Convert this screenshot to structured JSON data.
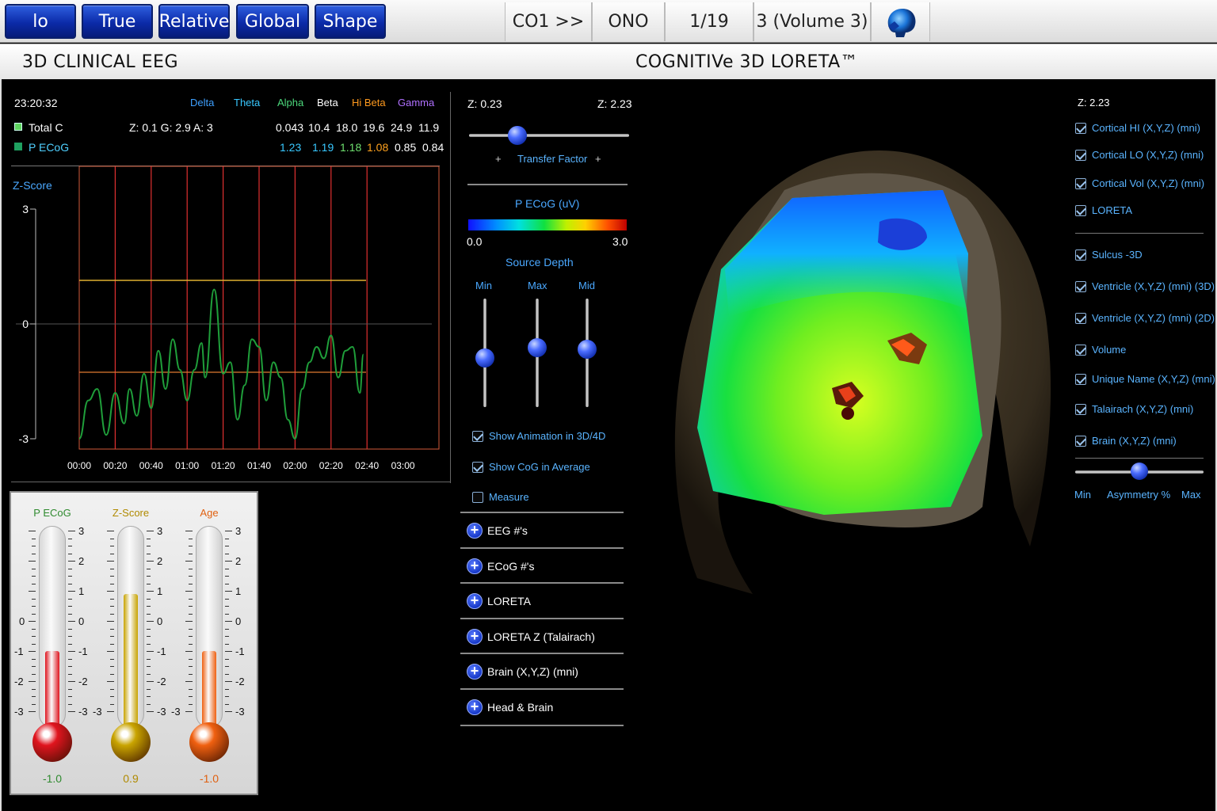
{
  "toolbar": {
    "buttons": [
      "lo",
      "True",
      "Relative",
      "Global",
      "Shape"
    ],
    "segments": [
      "CO1  >>",
      "ONO",
      "1/19",
      "3 (Volume 3)"
    ]
  },
  "title": {
    "left": "3D CLINICAL EEG",
    "right": "COGNITIVe 3D LORETA™"
  },
  "eeg": {
    "time": "23:20:32",
    "bands": [
      "Delta",
      "Theta",
      "Alpha",
      "Beta",
      "Hi Beta",
      "Gamma"
    ],
    "band_colors": [
      "#3ea0ff",
      "#38c8ff",
      "#4cd87c",
      "#ffffff",
      "#ff9a1e",
      "#b070ff"
    ],
    "row1": {
      "label": "Total C",
      "stats": "Z: 0.1   G: 2.9   A: 3",
      "values": [
        "0.043",
        "10.4",
        "18.0",
        "19.6",
        "24.9",
        "11.9"
      ]
    },
    "row2": {
      "label": "P ECoG",
      "values": [
        "1.23",
        "1.19",
        "1.18",
        "1.08",
        "0.85",
        "0.84"
      ],
      "value_colors": [
        "#38c8ff",
        "#38c8ff",
        "#6ee06e",
        "#ffa21e",
        "#ffffff",
        "#ffffff"
      ]
    }
  },
  "chart_data": {
    "type": "line",
    "title": "",
    "ylabel": "Z-Score",
    "xlabel": "",
    "ylim": [
      -3,
      3
    ],
    "yticks": [
      "3",
      "0",
      "-3"
    ],
    "xticks": [
      "00:00",
      "00:20",
      "00:40",
      "01:00",
      "01:20",
      "01:40",
      "02:00",
      "02:20",
      "02:40",
      "03:00"
    ],
    "series": [
      {
        "name": "P ECoG",
        "color": "#1f9e3a",
        "x": [
          0,
          5,
          10,
          15,
          20,
          25,
          28,
          32,
          36,
          40,
          44,
          48,
          52,
          56,
          60,
          64,
          68,
          70,
          75,
          80,
          84,
          88,
          92,
          96,
          100,
          104,
          108,
          112,
          116,
          120,
          124,
          128,
          132,
          136,
          140,
          144,
          148,
          152,
          156,
          158
        ],
        "values": [
          -3,
          -2.0,
          -1.7,
          -2.9,
          -1.8,
          -2.6,
          -1.7,
          -2.4,
          -1.3,
          -2.2,
          -0.7,
          -1.7,
          -0.4,
          -1.2,
          -2.0,
          -1.2,
          -0.5,
          -1.4,
          0.9,
          -1.3,
          -1.0,
          -2.5,
          -1.6,
          -0.4,
          -0.6,
          -2.0,
          -1.0,
          -1.4,
          -2.5,
          -3.0,
          -1.7,
          -1.0,
          -0.6,
          -0.9,
          -0.3,
          -1.4,
          -0.7,
          -0.6,
          -1.8,
          -0.8
        ]
      }
    ]
  },
  "controls": {
    "z_left": "Z: 0.23",
    "z_right": "Z: 2.23",
    "transfer": "Transfer Factor",
    "transfer_value": 0.3,
    "ecog_label": "P ECoG (uV)",
    "scale_min": "0.0",
    "scale_max": "3.0",
    "source_depth": "Source Depth",
    "depth_labels": [
      "Min",
      "Max",
      "Mid"
    ],
    "depth_values": [
      0.55,
      0.45,
      0.47
    ],
    "checks": [
      {
        "label": "Show Animation in 3D/4D",
        "checked": true
      },
      {
        "label": "Show CoG in Average",
        "checked": true
      },
      {
        "label": "Measure",
        "checked": false
      }
    ],
    "menu": [
      "EEG #'s",
      "ECoG #'s",
      "LORETA",
      "LORETA Z  (Talairach)",
      "Brain (X,Y,Z) (mni)",
      "Head & Brain"
    ]
  },
  "right_panel": {
    "z": "Z: 2.23",
    "checks": [
      "Cortical HI (X,Y,Z) (mni)",
      "Cortical LO (X,Y,Z) (mni)",
      "Cortical Vol (X,Y,Z) (mni)",
      "LORETA",
      "Sulcus -3D",
      "Ventricle (X,Y,Z) (mni) (3D)",
      "Ventricle (X,Y,Z) (mni) (2D)",
      "Volume",
      "Unique Name (X,Y,Z) (mni)",
      "Talairach (X,Y,Z) (mni)",
      "Brain (X,Y,Z) (mni)"
    ],
    "asym_min": "Min",
    "asym_label": "Asymmetry %",
    "asym_max": "Max",
    "asym_value": 0.5
  },
  "thermometers": [
    {
      "label": "P ECoG",
      "value": "-1.0",
      "color": "#e0141e",
      "label_color": "#2f8a2f",
      "level": -1.0
    },
    {
      "label": "Z-Score",
      "value": "0.9",
      "color": "#c9a400",
      "label_color": "#b08a00",
      "level": 0.9
    },
    {
      "label": "Age",
      "value": "-1.0",
      "color": "#f06010",
      "label_color": "#e06010",
      "level": -1.0
    }
  ],
  "therm_ticks": [
    "3",
    "2",
    "1",
    "0",
    "-1",
    "-2",
    "-3"
  ]
}
